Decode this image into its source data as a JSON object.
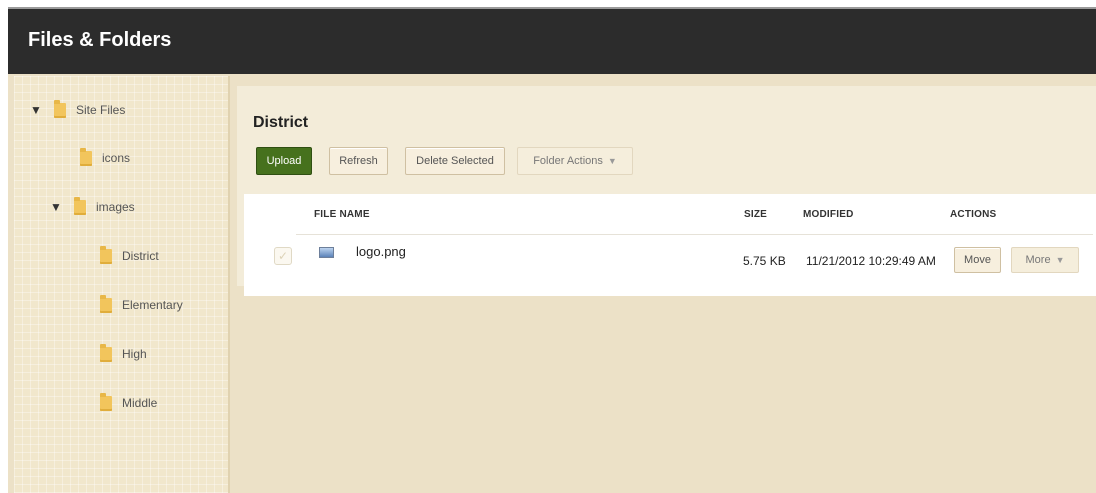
{
  "app": {
    "title": "Files & Folders"
  },
  "sidebar": {
    "items": [
      {
        "label": "Site Files",
        "icon": "folder-icon",
        "expanded": true
      },
      {
        "label": "icons",
        "icon": "folder-icon"
      },
      {
        "label": "images",
        "icon": "folder-icon",
        "expanded": true
      },
      {
        "label": "District",
        "icon": "folder-icon"
      },
      {
        "label": "Elementary",
        "icon": "folder-icon"
      },
      {
        "label": "High",
        "icon": "folder-icon"
      },
      {
        "label": "Middle",
        "icon": "folder-icon"
      }
    ]
  },
  "main": {
    "folder_title": "District",
    "toolbar": {
      "upload": "Upload",
      "refresh": "Refresh",
      "delete_selected": "Delete Selected",
      "folder_actions": "Folder Actions"
    },
    "table": {
      "headers": {
        "file_name": "FILE NAME",
        "size": "SIZE",
        "modified": "MODIFIED",
        "actions": "ACTIONS"
      },
      "rows": [
        {
          "file_name": "logo.png",
          "icon": "image-file-icon",
          "size": "5.75 KB",
          "modified": "11/21/2012 10:29:49 AM",
          "move": "Move",
          "more": "More"
        }
      ]
    }
  },
  "colors": {
    "topbar": "#2c2c2c",
    "upload_button": "#46711d",
    "background": "#ece1c7",
    "folder": "#f2c55c"
  }
}
